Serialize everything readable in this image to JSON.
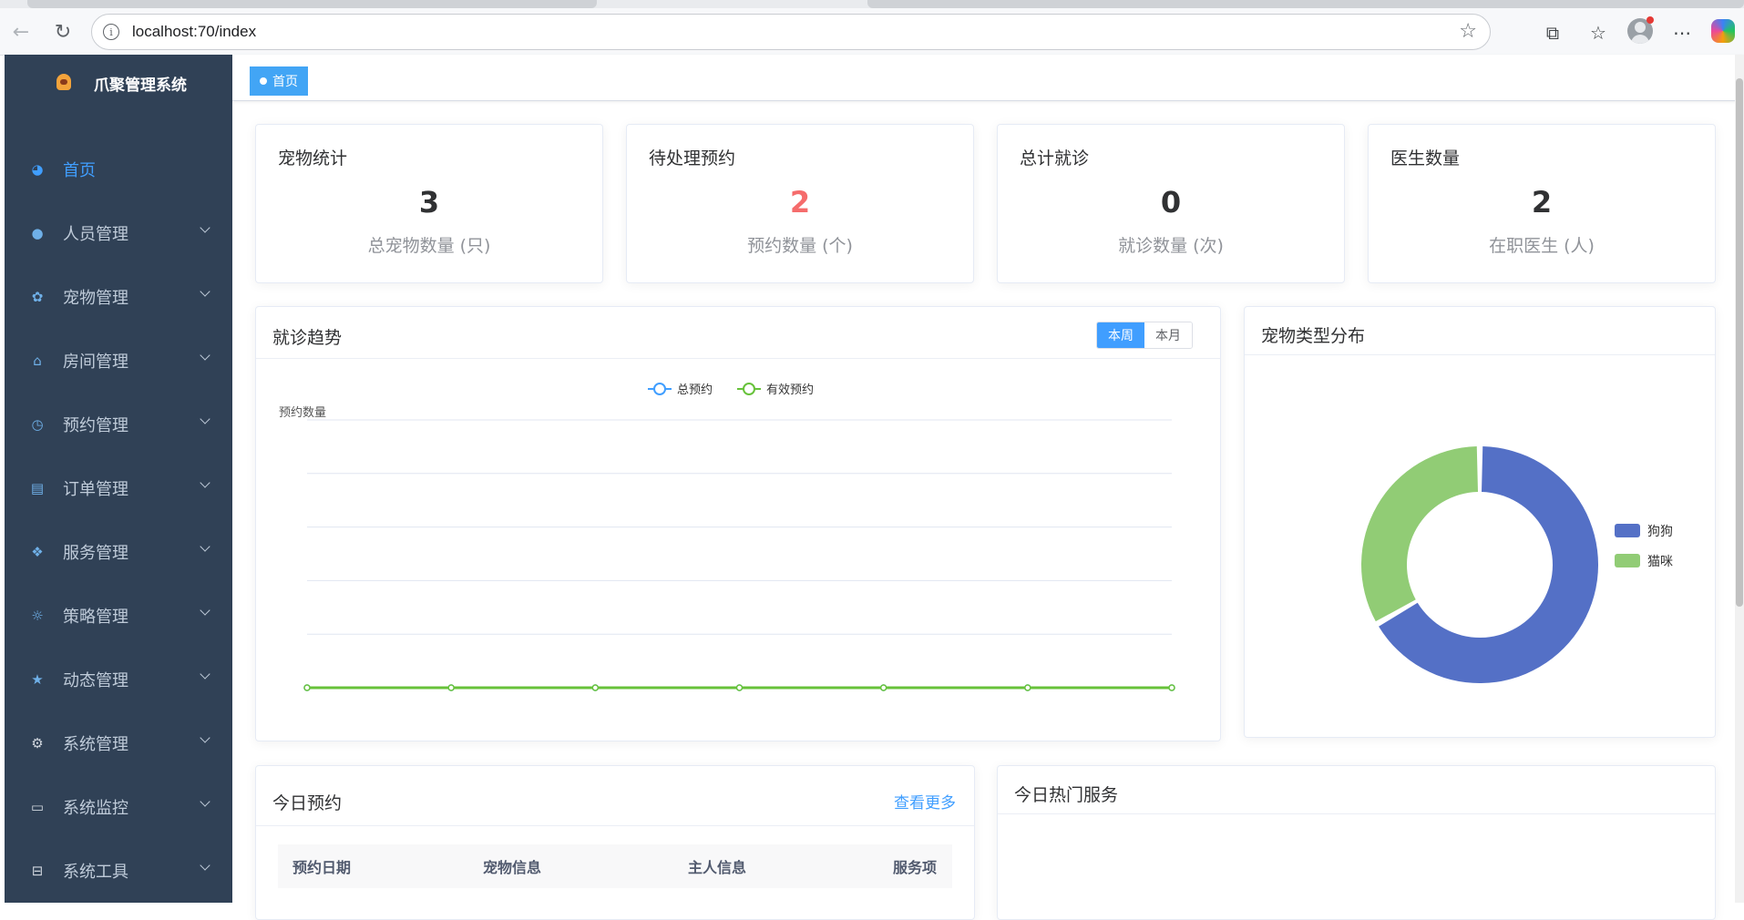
{
  "browser": {
    "url": "localhost:70/index"
  },
  "sidebar": {
    "app_title": "爪聚管理系统",
    "items": [
      {
        "label": "首页",
        "icon": "dashboard-icon",
        "active": true
      },
      {
        "label": "人员管理",
        "icon": "user-icon"
      },
      {
        "label": "宠物管理",
        "icon": "paw-icon"
      },
      {
        "label": "房间管理",
        "icon": "house-icon"
      },
      {
        "label": "预约管理",
        "icon": "clock-icon"
      },
      {
        "label": "订单管理",
        "icon": "clipboard-icon"
      },
      {
        "label": "服务管理",
        "icon": "service-icon"
      },
      {
        "label": "策略管理",
        "icon": "bulb-icon"
      },
      {
        "label": "动态管理",
        "icon": "star-icon"
      },
      {
        "label": "系统管理",
        "icon": "gear-icon"
      },
      {
        "label": "系统监控",
        "icon": "monitor-icon"
      },
      {
        "label": "系统工具",
        "icon": "toolbox-icon"
      }
    ]
  },
  "tags": {
    "home": "首页"
  },
  "stats": [
    {
      "title": "宠物统计",
      "value": "3",
      "desc": "总宠物数量 (只)",
      "highlight": false
    },
    {
      "title": "待处理预约",
      "value": "2",
      "desc": "预约数量 (个)",
      "highlight": true
    },
    {
      "title": "总计就诊",
      "value": "0",
      "desc": "就诊数量 (次)",
      "highlight": false
    },
    {
      "title": "医生数量",
      "value": "2",
      "desc": "在职医生 (人)",
      "highlight": false
    }
  ],
  "trend": {
    "title": "就诊趋势",
    "toggle": {
      "week": "本周",
      "month": "本月",
      "selected": "本周"
    }
  },
  "pet_types": {
    "title": "宠物类型分布"
  },
  "today_appointments": {
    "title": "今日预约",
    "more": "查看更多",
    "columns": [
      "预约日期",
      "宠物信息",
      "主人信息",
      "服务项"
    ]
  },
  "hot_services": {
    "title": "今日热门服务"
  },
  "chart_data": [
    {
      "type": "line",
      "ylabel": "预约数量",
      "series": [
        {
          "name": "总预约",
          "color": "#409eff",
          "values": [
            0,
            0,
            0,
            0,
            0,
            0,
            0
          ]
        },
        {
          "name": "有效预约",
          "color": "#67c23a",
          "values": [
            0,
            0,
            0,
            0,
            0,
            0,
            0
          ]
        }
      ],
      "grid": true,
      "legend": "top-center"
    },
    {
      "type": "pie",
      "donut": true,
      "slices": [
        {
          "name": "狗狗",
          "value": 2,
          "color": "#5470c6"
        },
        {
          "name": "猫咪",
          "value": 1,
          "color": "#91cc75"
        }
      ],
      "legend": "right"
    }
  ]
}
